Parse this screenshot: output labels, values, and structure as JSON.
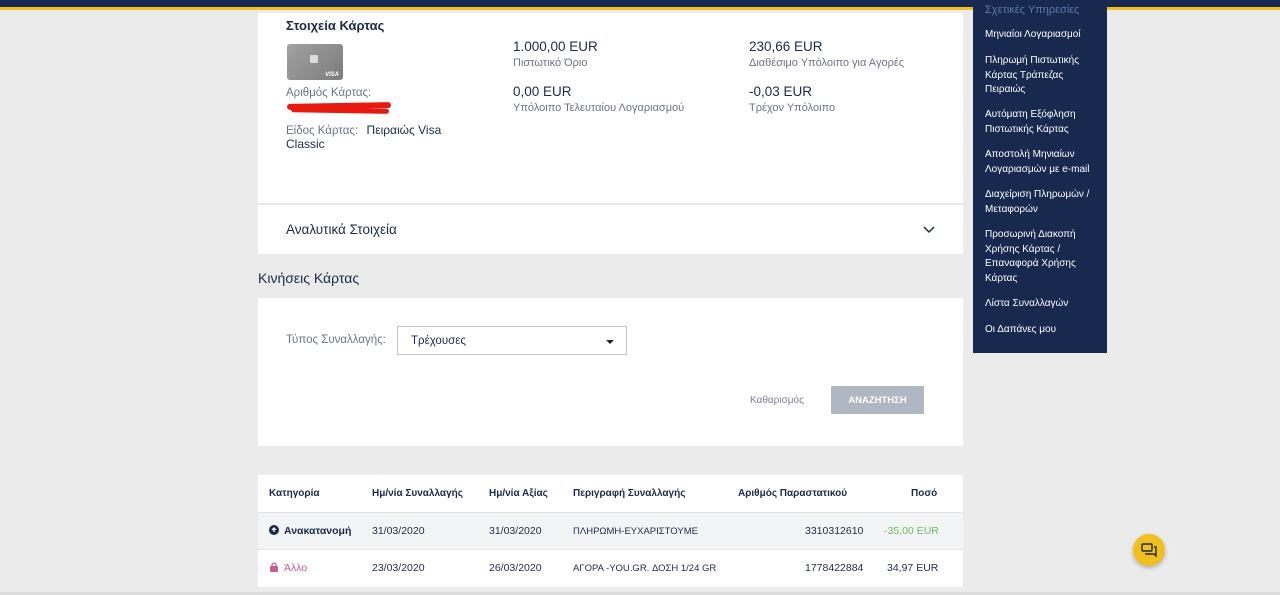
{
  "card": {
    "title": "Στοιχεία Κάρτας",
    "card_brand": "VISA",
    "number_label": "Αριθμός Κάρτας:",
    "type_label": "Είδος Κάρτας:",
    "type_value_1": "Πειραιώς Visa",
    "type_value_2": "Classic",
    "credit_limit_value": "1.000,00 EUR",
    "credit_limit_label": "Πιστωτικό Όριο",
    "available_value": "230,66 EUR",
    "available_label": "Διαθέσιμο Υπόλοιπο για Αγορές",
    "last_statement_value": "0,00 EUR",
    "last_statement_label": "Υπόλοιπο Τελευταίου Λογαριασμού",
    "current_value": "-0,03 EUR",
    "current_label": "Τρέχον Υπόλοιπο"
  },
  "details": {
    "title": "Αναλυτικά Στοιχεία"
  },
  "movements": {
    "title": "Κινήσεις Κάρτας",
    "filter_label": "Τύπος Συναλλαγής:",
    "filter_value": "Τρέχουσες",
    "clear_label": "Καθαρισμός",
    "search_label": "ΑΝΑΖΗΤΗΣΗ"
  },
  "table": {
    "headers": [
      "Κατηγορία",
      "Ημ/νία Συναλλαγής",
      "Ημ/νία Αξίας",
      "Περιγραφή Συναλλαγής",
      "Αριθμός Παραστατικού",
      "Ποσό"
    ],
    "rows": [
      {
        "category": "Ανακατανομή",
        "tx_date": "31/03/2020",
        "value_date": "31/03/2020",
        "description": "ΠΛΗΡΩΜΗ-ΕΥΧΑΡΙΣΤΟΥΜΕ",
        "doc_no": "3310312610",
        "amount": "-35,00 EUR",
        "icon": "refund-icon",
        "amount_color": "#6cbf5d"
      },
      {
        "category": "Άλλο",
        "tx_date": "23/03/2020",
        "value_date": "26/03/2020",
        "description": "ΑΓΟΡΑ -YOU.GR. ΔΟΣΗ 1/24 GR",
        "doc_no": "1778422884",
        "amount": "34,97 EUR",
        "icon": "shopping-bag-icon",
        "category_color": "#cd5a8f"
      }
    ]
  },
  "sidebar": {
    "heading": "Σχετικές Υπηρεσίες",
    "items": [
      {
        "l1": "Μηνιαίοι Λογαριασμοί"
      },
      {
        "l1": "Πληρωμή Πιστωτικής",
        "l2": "Κάρτας Τράπεζας",
        "l3": "Πειραιώς"
      },
      {
        "l1": "Αυτόματη Εξόφληση",
        "l2": "Πιστωτικής Κάρτας"
      },
      {
        "l1": "Αποστολή Μηνιαίων",
        "l2": "Λογαριασμών με e-mail"
      },
      {
        "l1": "Διαχείριση Πληρωμών /",
        "l2": "Μεταφορών"
      },
      {
        "l1": "Προσωρινή Διακοπή",
        "l2": "Χρήσης Κάρτας /",
        "l3": "Επαναφορά Χρήσης",
        "l4": "Κάρτας"
      },
      {
        "l1": "Λίστα Συναλλαγών"
      },
      {
        "l1": "Οι Δαπάνες μου"
      }
    ]
  },
  "chat": {
    "icon": "chat-bubble-icon"
  },
  "colors": {
    "navy": "#17294f",
    "accent_yellow": "#f2c01e",
    "positive_green": "#6cbf5d",
    "category_pink": "#cd5a8f"
  }
}
